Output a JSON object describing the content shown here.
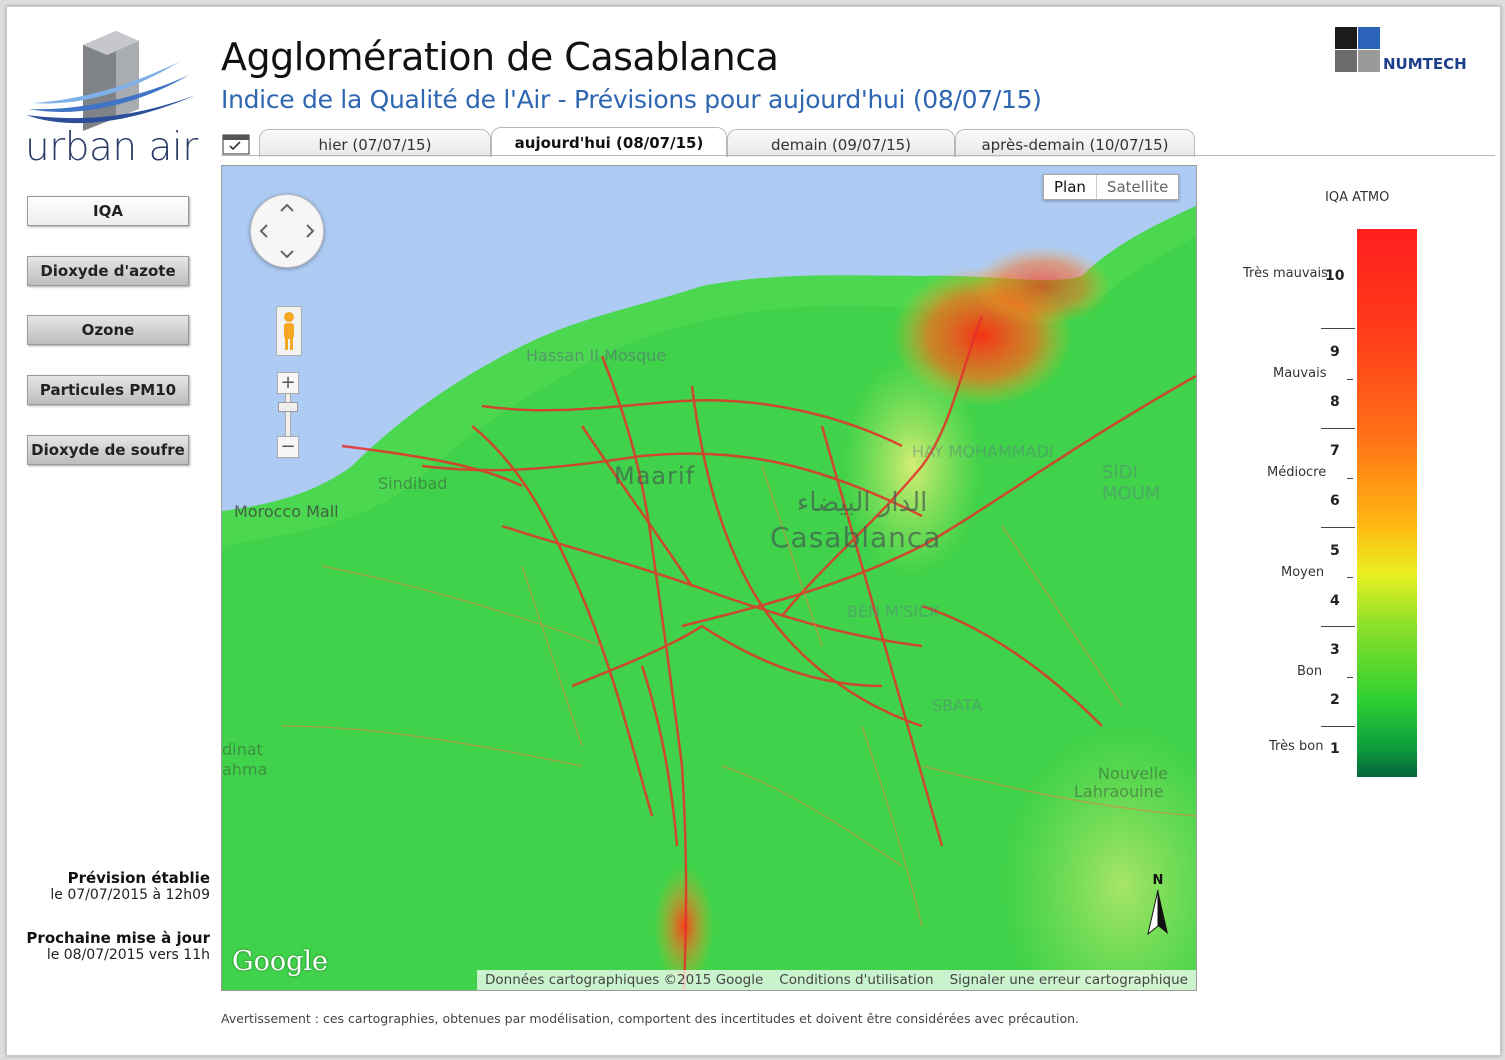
{
  "header": {
    "logo_text": "urban air",
    "title": "Agglomération de Casablanca",
    "subtitle": "Indice de la Qualité de l'Air - Prévisions pour aujourd'hui (08/07/15)",
    "partner_logo": "NUMTECH"
  },
  "tabs": [
    {
      "label": "hier (07/07/15)",
      "active": false
    },
    {
      "label": "aujourd'hui (08/07/15)",
      "active": true
    },
    {
      "label": "demain (09/07/15)",
      "active": false
    },
    {
      "label": "après-demain (10/07/15)",
      "active": false
    }
  ],
  "nav": [
    {
      "label": "IQA",
      "selected": true
    },
    {
      "label": "Dioxyde d'azote",
      "selected": false
    },
    {
      "label": "Ozone",
      "selected": false
    },
    {
      "label": "Particules PM10",
      "selected": false
    },
    {
      "label": "Dioxyde de soufre",
      "selected": false
    }
  ],
  "forecast": {
    "established_title": "Prévision établie",
    "established_date": "le 07/07/2015 à 12h09",
    "next_title": "Prochaine mise à jour",
    "next_date": "le 08/07/2015 vers 11h"
  },
  "map": {
    "type_plan": "Plan",
    "type_satellite": "Satellite",
    "google_label": "Google",
    "footer_data": "Données cartographiques ©2015 Google",
    "footer_terms": "Conditions d'utilisation",
    "footer_report": "Signaler une erreur cartographique",
    "north": "N",
    "labels": {
      "casablanca": "Casablanca",
      "casablanca_ar": "الدار البيضاء",
      "maarif": "Maarif",
      "sindibad": "Sindibad",
      "morocco_mall": "Morocco Mall",
      "hassan_mosque": "Hassan II Mosque",
      "nouvelle": "Nouvelle",
      "lahraouine": "Lahraouine",
      "sidi_moumen": "SIDI MOUM",
      "ben_msick": "BEN M'SICK",
      "sbata": "SBATA",
      "hay_mohammadi": "HAY MOHAMMADI",
      "dinat": "dinat",
      "rahma": "ahma"
    }
  },
  "legend": {
    "title": "IQA ATMO",
    "numbers": [
      "10",
      "9",
      "8",
      "7",
      "6",
      "5",
      "4",
      "3",
      "2",
      "1"
    ],
    "levels": [
      "Très mauvais",
      "Mauvais",
      "Médiocre",
      "Moyen",
      "Bon",
      "Très bon"
    ]
  },
  "footer": {
    "warning": "Avertissement : ces cartographies, obtenues par modélisation, comportent des incertitudes et doivent être considérées avec précaution."
  }
}
